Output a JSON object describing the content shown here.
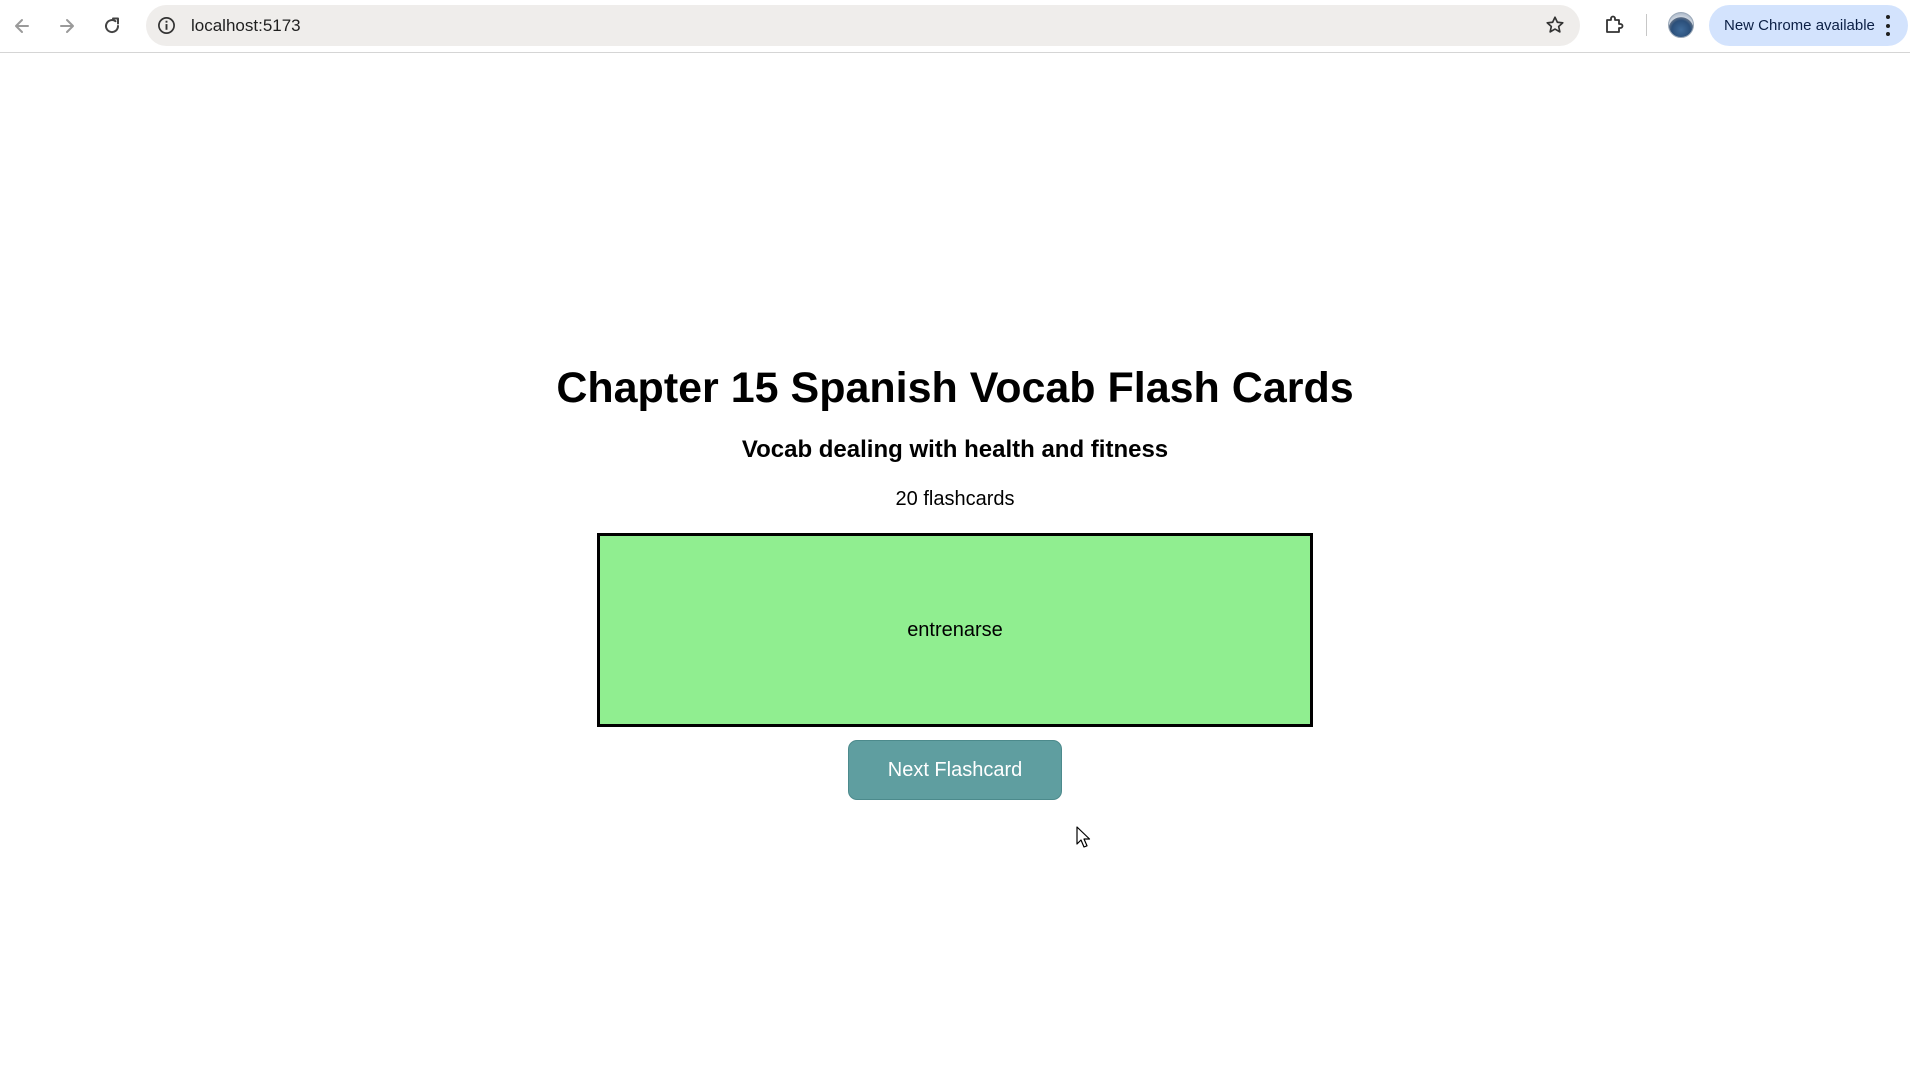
{
  "browser": {
    "url": "localhost:5173",
    "update_label": "New Chrome available",
    "icons": {
      "back": "arrow-left-icon",
      "forward": "arrow-right-icon",
      "reload": "reload-icon",
      "site_info": "info-icon",
      "bookmark": "star-icon",
      "extensions": "puzzle-icon",
      "menu": "kebab-menu-icon"
    }
  },
  "page": {
    "title": "Chapter 15 Spanish Vocab Flash Cards",
    "subtitle": "Vocab dealing with health and fitness",
    "count_label": "20 flashcards",
    "card": {
      "text": "entrenarse",
      "color": "#90ee90"
    },
    "next_button_label": "Next Flashcard",
    "next_button_color": "#5f9ea0"
  }
}
